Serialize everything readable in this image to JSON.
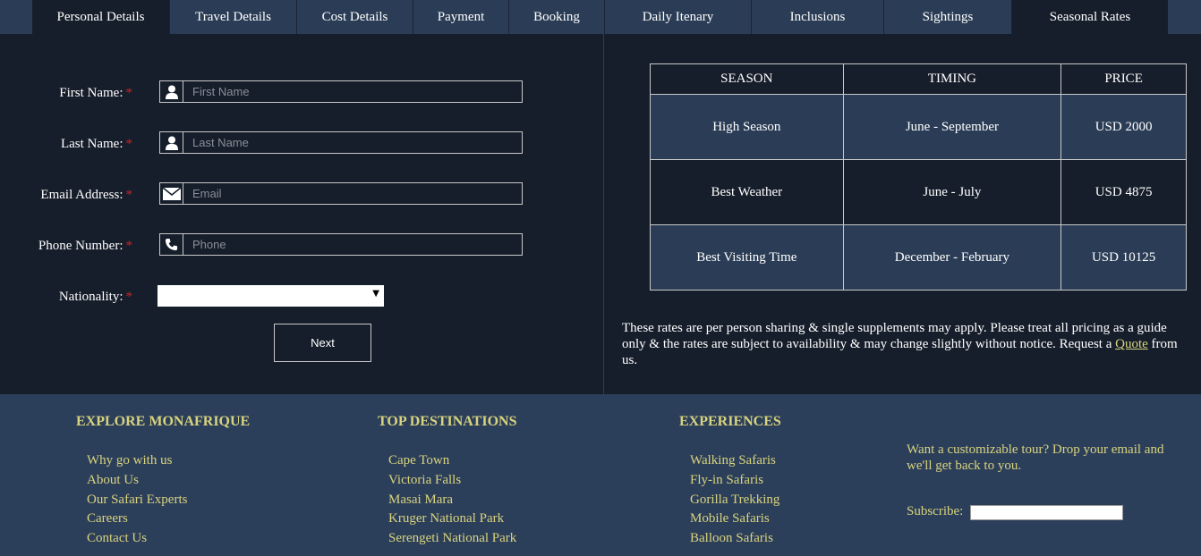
{
  "tabs": [
    {
      "label": "Personal Details"
    },
    {
      "label": "Travel Details"
    },
    {
      "label": "Cost Details"
    },
    {
      "label": "Payment"
    },
    {
      "label": "Booking"
    },
    {
      "label": "Daily Itenary"
    },
    {
      "label": "Inclusions"
    },
    {
      "label": "Sightings"
    },
    {
      "label": "Seasonal Rates"
    }
  ],
  "form": {
    "first_name": {
      "label": "First Name:",
      "required": "*",
      "placeholder": "First Name",
      "value": ""
    },
    "last_name": {
      "label": "Last Name:",
      "required": "*",
      "placeholder": "Last Name",
      "value": ""
    },
    "email": {
      "label": "Email Address:",
      "required": "*",
      "placeholder": "Email",
      "value": ""
    },
    "phone": {
      "label": "Phone Number:",
      "required": "*",
      "placeholder": "Phone",
      "value": ""
    },
    "nationality": {
      "label": "Nationality:",
      "required": "*",
      "value": ""
    },
    "next_label": "Next"
  },
  "rates": {
    "headers": [
      "SEASON",
      "TIMING",
      "PRICE"
    ],
    "rows": [
      {
        "season": "High Season",
        "timing": "June - September",
        "price": "USD 2000"
      },
      {
        "season": "Best Weather",
        "timing": "June - July",
        "price": "USD 4875"
      },
      {
        "season": "Best Visiting Time",
        "timing": "December - February",
        "price": "USD 10125"
      }
    ],
    "note_before": "These rates are per person sharing & single supplements may apply. Please treat all pricing as a guide only & the rates are subject to availability & may change slightly without notice. Request a ",
    "note_link": "Quote",
    "note_after": " from us."
  },
  "footer": {
    "explore": {
      "title": "EXPLORE MONAFRIQUE",
      "links": [
        "Why go with us",
        "About Us",
        "Our Safari Experts",
        "Careers",
        "Contact Us"
      ]
    },
    "destinations": {
      "title": "TOP DESTINATIONS",
      "links": [
        "Cape Town",
        "Victoria Falls",
        "Masai Mara",
        "Kruger National Park",
        "Serengeti National Park"
      ]
    },
    "experiences": {
      "title": "EXPERIENCES",
      "links": [
        "Walking Safaris",
        "Fly-in Safaris",
        "Gorilla Trekking",
        "Mobile Safaris",
        "Balloon Safaris"
      ]
    },
    "cta_text": "Want a customizable tour? Drop your email and we'll get back to you.",
    "subscribe_label": "Subscribe:",
    "subscribe_value": ""
  },
  "colors": {
    "background": "#161e2b",
    "panel": "#2b3d56",
    "accent": "#d8d37e",
    "required": "#d61f1f"
  },
  "icons": {
    "first_name": "user-icon",
    "last_name": "user-icon",
    "email": "envelope-icon",
    "phone": "phone-icon",
    "select": "caret-down-icon"
  }
}
